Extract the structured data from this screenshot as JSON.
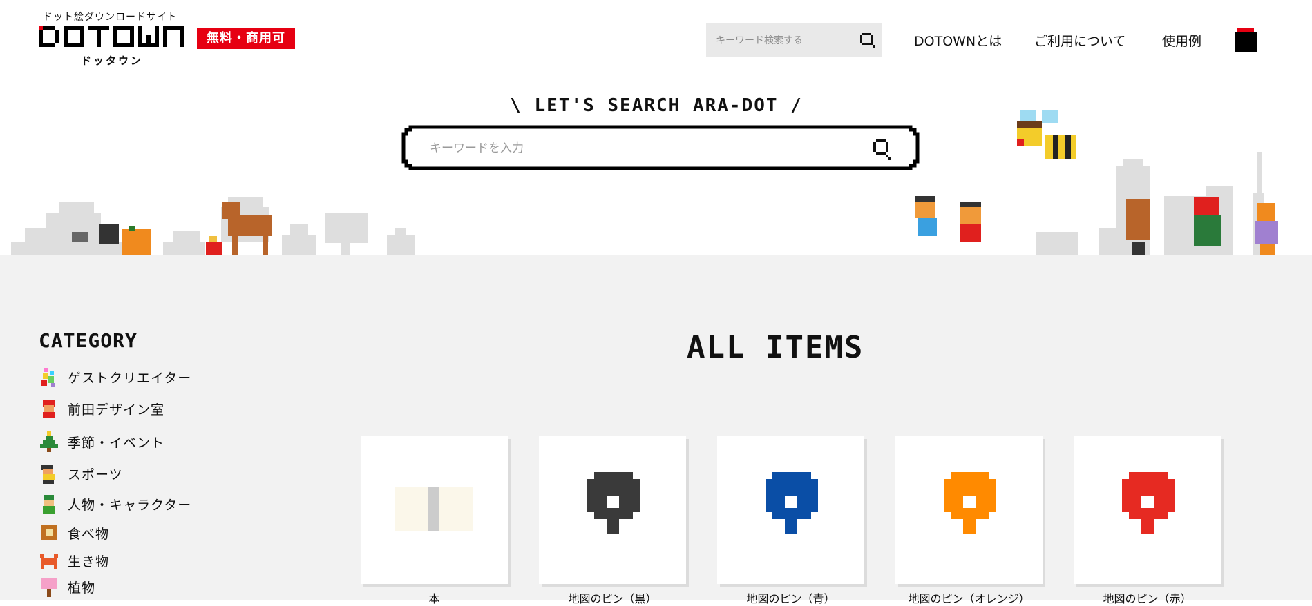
{
  "header": {
    "site_tagline": "ドット絵ダウンロードサイト",
    "logo_text": "DOTOWN",
    "logo_kana": "ドッタウン",
    "badge": "無料・商用可",
    "search_placeholder": "キーワード検索する",
    "nav": [
      "DOTOWNとは",
      "ご利用について",
      "使用例"
    ]
  },
  "hero": {
    "title": "\\ LET'S SEARCH ARA-DOT /",
    "search_placeholder": "キーワードを入力"
  },
  "sidebar": {
    "title": "CATEGORY",
    "items": [
      {
        "label": "ゲストクリエイター",
        "icon": "guest-creator-icon"
      },
      {
        "label": "前田デザイン室",
        "icon": "maeda-design-icon"
      },
      {
        "label": "季節・イベント",
        "icon": "christmas-tree-icon"
      },
      {
        "label": "スポーツ",
        "icon": "sports-icon"
      },
      {
        "label": "人物・キャラクター",
        "icon": "person-icon"
      },
      {
        "label": "食べ物",
        "icon": "food-icon"
      },
      {
        "label": "生き物",
        "icon": "crab-icon"
      },
      {
        "label": "植物",
        "icon": "plant-icon"
      }
    ]
  },
  "main": {
    "title": "ALL ITEMS",
    "items": [
      {
        "label": "本",
        "icon": "book-icon"
      },
      {
        "label": "地図のピン（黒）",
        "icon": "map-pin-icon",
        "color": "#3a3a3a"
      },
      {
        "label": "地図のピン（青）",
        "icon": "map-pin-icon",
        "color": "#0a4ea6"
      },
      {
        "label": "地図のピン（オレンジ）",
        "icon": "map-pin-icon",
        "color": "#ff8a00"
      },
      {
        "label": "地図のピン（赤）",
        "icon": "map-pin-icon",
        "color": "#e62a22"
      }
    ]
  },
  "colors": {
    "badge_red": "#e60012",
    "background_gray": "#f2f2f2"
  }
}
